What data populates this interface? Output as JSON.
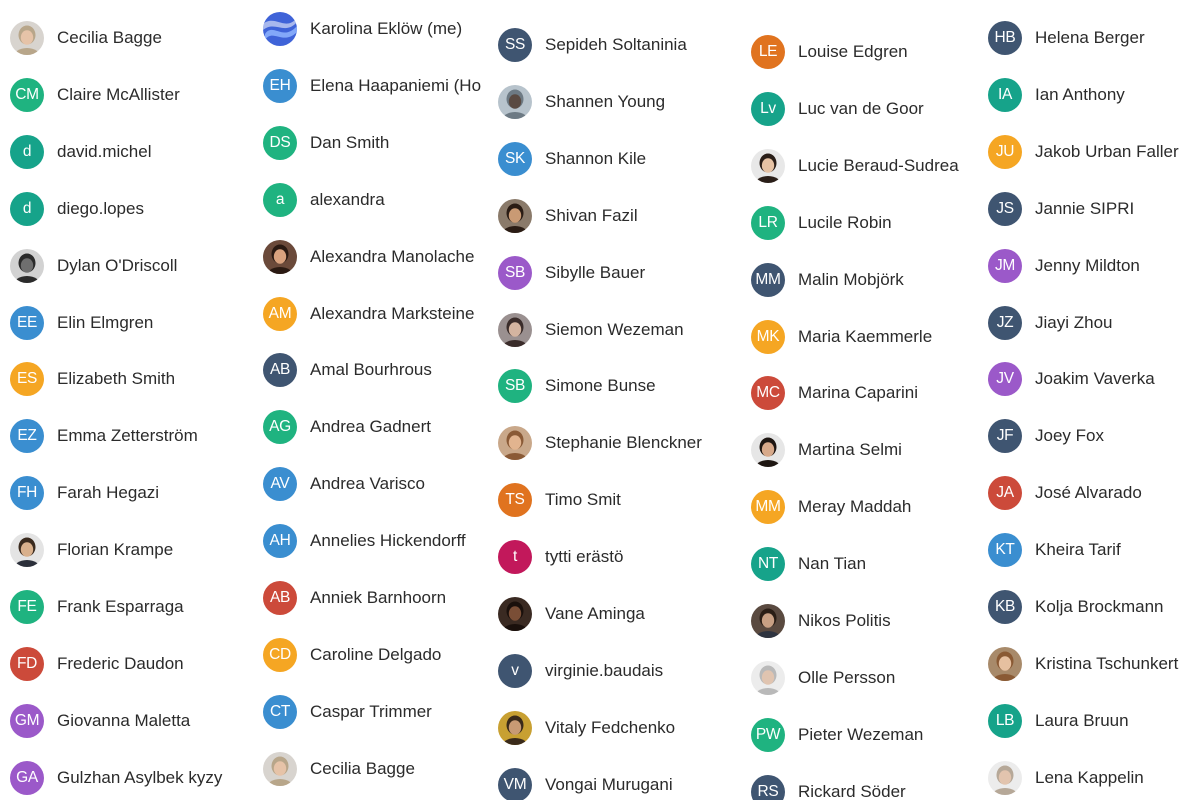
{
  "colors": {
    "gray": "#c9c9c9",
    "green": "#1fb380",
    "teal": "#16a38a",
    "blue": "#3a8ed0",
    "orange": "#f5a623",
    "burnt": "#e0731f",
    "red": "#cc4a3a",
    "purple": "#9b59c9",
    "navy": "#3f5571",
    "magenta": "#c2185b"
  },
  "columns": [
    {
      "people": [
        {
          "name": "Cecilia Bagge",
          "avatar": {
            "kind": "photo",
            "icon": "person-photo-icon",
            "bg": "#d8d4cf",
            "skin": "#e6c3a8",
            "hair": "#b8a68a"
          }
        },
        {
          "name": "Claire McAllister",
          "avatar": {
            "kind": "initials",
            "initials": "CM",
            "color": "green"
          }
        },
        {
          "name": "david.michel",
          "avatar": {
            "kind": "initials",
            "initials": "d",
            "color": "teal"
          }
        },
        {
          "name": "diego.lopes",
          "avatar": {
            "kind": "initials",
            "initials": "d",
            "color": "teal"
          }
        },
        {
          "name": "Dylan O'Driscoll",
          "avatar": {
            "kind": "photo",
            "icon": "person-photo-icon",
            "bg": "#d2d2d2",
            "skin": "#6f6f6f",
            "hair": "#2b2b2b"
          }
        },
        {
          "name": "Elin Elmgren",
          "avatar": {
            "kind": "initials",
            "initials": "EE",
            "color": "blue"
          }
        },
        {
          "name": "Elizabeth Smith",
          "avatar": {
            "kind": "initials",
            "initials": "ES",
            "color": "orange"
          }
        },
        {
          "name": "Emma Zetterström",
          "avatar": {
            "kind": "initials",
            "initials": "EZ",
            "color": "blue"
          }
        },
        {
          "name": "Farah Hegazi",
          "avatar": {
            "kind": "initials",
            "initials": "FH",
            "color": "blue"
          }
        },
        {
          "name": "Florian Krampe",
          "avatar": {
            "kind": "photo",
            "icon": "person-photo-icon",
            "bg": "#e4e4e4",
            "skin": "#d9b08c",
            "hair": "#3a2a1e",
            "shirt": "#2b2f3a"
          }
        },
        {
          "name": "Frank Esparraga",
          "avatar": {
            "kind": "initials",
            "initials": "FE",
            "color": "green"
          }
        },
        {
          "name": "Frederic Daudon",
          "avatar": {
            "kind": "initials",
            "initials": "FD",
            "color": "red"
          }
        },
        {
          "name": "Giovanna Maletta",
          "avatar": {
            "kind": "initials",
            "initials": "GM",
            "color": "purple"
          }
        },
        {
          "name": "Gulzhan Asylbek kyzy",
          "avatar": {
            "kind": "initials",
            "initials": "GA",
            "color": "purple"
          }
        }
      ]
    },
    {
      "people": [
        {
          "name": "Karolina Eklöw (me)",
          "avatar": {
            "kind": "swirl",
            "icon": "swirl-avatar-icon"
          }
        },
        {
          "name": "Elena Haapaniemi (Ho",
          "avatar": {
            "kind": "initials",
            "initials": "EH",
            "color": "blue"
          }
        },
        {
          "name": "Dan Smith",
          "avatar": {
            "kind": "initials",
            "initials": "DS",
            "color": "green"
          }
        },
        {
          "name": "alexandra",
          "avatar": {
            "kind": "initials",
            "initials": "a",
            "color": "green"
          }
        },
        {
          "name": "Alexandra Manolache",
          "avatar": {
            "kind": "photo",
            "icon": "person-photo-icon",
            "bg": "#6b4a3a",
            "skin": "#d9a27e",
            "hair": "#2a1a12"
          }
        },
        {
          "name": "Alexandra Marksteine",
          "avatar": {
            "kind": "initials",
            "initials": "AM",
            "color": "orange"
          }
        },
        {
          "name": "Amal Bourhrous",
          "avatar": {
            "kind": "initials",
            "initials": "AB",
            "color": "navy"
          }
        },
        {
          "name": "Andrea Gadnert",
          "avatar": {
            "kind": "initials",
            "initials": "AG",
            "color": "green"
          }
        },
        {
          "name": "Andrea Varisco",
          "avatar": {
            "kind": "initials",
            "initials": "AV",
            "color": "blue"
          }
        },
        {
          "name": "Annelies Hickendorff",
          "avatar": {
            "kind": "initials",
            "initials": "AH",
            "color": "blue"
          }
        },
        {
          "name": "Anniek Barnhoorn",
          "avatar": {
            "kind": "initials",
            "initials": "AB",
            "color": "red"
          }
        },
        {
          "name": "Caroline Delgado",
          "avatar": {
            "kind": "initials",
            "initials": "CD",
            "color": "orange"
          }
        },
        {
          "name": "Caspar Trimmer",
          "avatar": {
            "kind": "initials",
            "initials": "CT",
            "color": "blue"
          }
        },
        {
          "name": "Cecilia Bagge",
          "avatar": {
            "kind": "photo",
            "icon": "person-photo-icon",
            "bg": "#d8d4cf",
            "skin": "#e6c3a8",
            "hair": "#b8a68a"
          }
        }
      ]
    },
    {
      "people": [
        {
          "name": "Sepideh Soltaninia",
          "avatar": {
            "kind": "initials",
            "initials": "SS",
            "color": "navy"
          }
        },
        {
          "name": "Shannen Young",
          "avatar": {
            "kind": "photo",
            "icon": "person-photo-icon",
            "bg": "#b7c3cc",
            "skin": "#5a4a42",
            "hair": "#6d7a84"
          }
        },
        {
          "name": "Shannon Kile",
          "avatar": {
            "kind": "initials",
            "initials": "SK",
            "color": "blue"
          }
        },
        {
          "name": "Shivan Fazil",
          "avatar": {
            "kind": "photo",
            "icon": "person-photo-icon",
            "bg": "#8a7a6a",
            "skin": "#c99a74",
            "hair": "#2a1c14"
          }
        },
        {
          "name": "Sibylle Bauer",
          "avatar": {
            "kind": "initials",
            "initials": "SB",
            "color": "purple"
          }
        },
        {
          "name": "Siemon Wezeman",
          "avatar": {
            "kind": "photo",
            "icon": "person-photo-icon",
            "bg": "#9a9090",
            "skin": "#d4b4a0",
            "hair": "#3a2c2a"
          }
        },
        {
          "name": "Simone Bunse",
          "avatar": {
            "kind": "initials",
            "initials": "SB",
            "color": "green"
          }
        },
        {
          "name": "Stephanie Blenckner",
          "avatar": {
            "kind": "photo",
            "icon": "person-photo-icon",
            "bg": "#c9a88a",
            "skin": "#e2b48f",
            "hair": "#8a5a36"
          }
        },
        {
          "name": "Timo Smit",
          "avatar": {
            "kind": "initials",
            "initials": "TS",
            "color": "burnt"
          }
        },
        {
          "name": "tytti erästö",
          "avatar": {
            "kind": "initials",
            "initials": "t",
            "color": "magenta"
          }
        },
        {
          "name": "Vane Aminga",
          "avatar": {
            "kind": "photo",
            "icon": "person-photo-icon",
            "bg": "#3a2a22",
            "skin": "#7a4e36",
            "hair": "#1a100c"
          }
        },
        {
          "name": "virginie.baudais",
          "avatar": {
            "kind": "initials",
            "initials": "v",
            "color": "navy"
          }
        },
        {
          "name": "Vitaly Fedchenko",
          "avatar": {
            "kind": "photo",
            "icon": "person-photo-icon",
            "bg": "#c8a032",
            "skin": "#c89a74",
            "hair": "#3a2a1a"
          }
        },
        {
          "name": "Vongai Murugani",
          "avatar": {
            "kind": "initials",
            "initials": "VM",
            "color": "navy"
          }
        }
      ]
    },
    {
      "people": [
        {
          "name": "Louise Edgren",
          "avatar": {
            "kind": "initials",
            "initials": "LE",
            "color": "burnt"
          }
        },
        {
          "name": "Luc van de Goor",
          "avatar": {
            "kind": "initials",
            "initials": "Lv",
            "color": "teal"
          }
        },
        {
          "name": "Lucie Beraud-Sudrea",
          "avatar": {
            "kind": "photo",
            "icon": "person-photo-icon",
            "bg": "#e8e8e8",
            "skin": "#e6c2a4",
            "hair": "#2a1e18"
          }
        },
        {
          "name": "Lucile Robin",
          "avatar": {
            "kind": "initials",
            "initials": "LR",
            "color": "green"
          }
        },
        {
          "name": "Malin Mobjörk",
          "avatar": {
            "kind": "initials",
            "initials": "MM",
            "color": "navy"
          }
        },
        {
          "name": "Maria Kaemmerle",
          "avatar": {
            "kind": "initials",
            "initials": "MK",
            "color": "orange"
          }
        },
        {
          "name": "Marina Caparini",
          "avatar": {
            "kind": "initials",
            "initials": "MC",
            "color": "red"
          }
        },
        {
          "name": "Martina Selmi",
          "avatar": {
            "kind": "photo",
            "icon": "person-photo-icon",
            "bg": "#e6e6e6",
            "skin": "#d7a98a",
            "hair": "#1e1612"
          }
        },
        {
          "name": "Meray Maddah",
          "avatar": {
            "kind": "initials",
            "initials": "MM",
            "color": "orange"
          }
        },
        {
          "name": "Nan Tian",
          "avatar": {
            "kind": "initials",
            "initials": "NT",
            "color": "teal"
          }
        },
        {
          "name": "Nikos Politis",
          "avatar": {
            "kind": "photo",
            "icon": "person-photo-icon",
            "bg": "#5a4a40",
            "skin": "#c8a084",
            "hair": "#2a1e16",
            "shirt": "#2e3440"
          }
        },
        {
          "name": "Olle Persson",
          "avatar": {
            "kind": "photo",
            "icon": "person-photo-icon",
            "bg": "#ececec",
            "skin": "#e0c4b0",
            "hair": "#b9b9b9"
          }
        },
        {
          "name": "Pieter Wezeman",
          "avatar": {
            "kind": "initials",
            "initials": "PW",
            "color": "green"
          }
        },
        {
          "name": "Rickard Söder",
          "avatar": {
            "kind": "initials",
            "initials": "RS",
            "color": "navy"
          }
        }
      ]
    },
    {
      "people": [
        {
          "name": "Helena Berger",
          "avatar": {
            "kind": "initials",
            "initials": "HB",
            "color": "navy"
          }
        },
        {
          "name": "Ian Anthony",
          "avatar": {
            "kind": "initials",
            "initials": "IA",
            "color": "teal"
          }
        },
        {
          "name": "Jakob Urban Faller",
          "avatar": {
            "kind": "initials",
            "initials": "JU",
            "color": "orange"
          }
        },
        {
          "name": "Jannie SIPRI",
          "avatar": {
            "kind": "initials",
            "initials": "JS",
            "color": "navy"
          }
        },
        {
          "name": "Jenny Mildton",
          "avatar": {
            "kind": "initials",
            "initials": "JM",
            "color": "purple"
          }
        },
        {
          "name": "Jiayi Zhou",
          "avatar": {
            "kind": "initials",
            "initials": "JZ",
            "color": "navy"
          }
        },
        {
          "name": "Joakim Vaverka",
          "avatar": {
            "kind": "initials",
            "initials": "JV",
            "color": "purple"
          }
        },
        {
          "name": "Joey Fox",
          "avatar": {
            "kind": "initials",
            "initials": "JF",
            "color": "navy"
          }
        },
        {
          "name": "José Alvarado",
          "avatar": {
            "kind": "initials",
            "initials": "JA",
            "color": "red"
          }
        },
        {
          "name": "Kheira Tarif",
          "avatar": {
            "kind": "initials",
            "initials": "KT",
            "color": "blue"
          }
        },
        {
          "name": "Kolja Brockmann",
          "avatar": {
            "kind": "initials",
            "initials": "KB",
            "color": "navy"
          }
        },
        {
          "name": "Kristina Tschunkert",
          "avatar": {
            "kind": "photo",
            "icon": "person-photo-icon",
            "bg": "#a88a6a",
            "skin": "#e6c0a0",
            "hair": "#8a5a34"
          }
        },
        {
          "name": "Laura Bruun",
          "avatar": {
            "kind": "initials",
            "initials": "LB",
            "color": "teal"
          }
        },
        {
          "name": "Lena Kappelin",
          "avatar": {
            "kind": "photo",
            "icon": "person-photo-icon",
            "bg": "#ececec",
            "skin": "#e2c4ae",
            "hair": "#b6a898"
          }
        }
      ]
    }
  ]
}
